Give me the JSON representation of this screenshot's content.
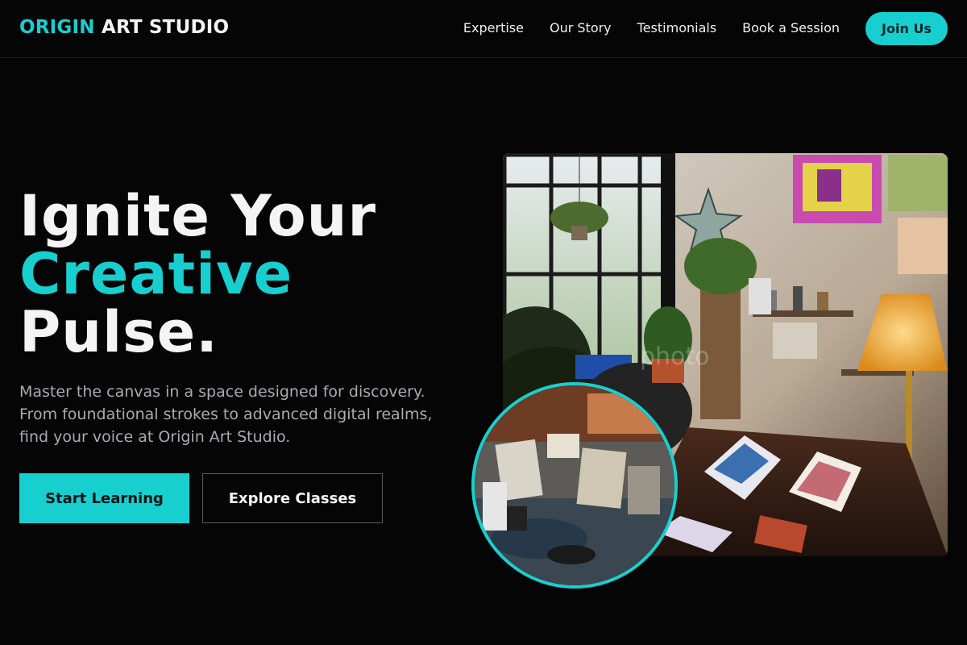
{
  "nav": {
    "logo_accent": "ORIGIN",
    "logo_rest": "ART STUDIO",
    "links": [
      "Expertise",
      "Our Story",
      "Testimonials",
      "Book a Session"
    ],
    "cta": "Join Us"
  },
  "hero": {
    "headline_line1": "Ignite Your",
    "headline_line2": "Creative",
    "headline_line3": "Pulse.",
    "subtext": "Master the canvas in a space designed for discovery. From foundational strokes to advanced digital realms, find your voice at Origin Art Studio.",
    "primary_button": "Start Learning",
    "secondary_button": "Explore Classes"
  },
  "colors": {
    "accent": "#18cfd0",
    "background": "#050505",
    "muted_text": "#a8abb2"
  }
}
